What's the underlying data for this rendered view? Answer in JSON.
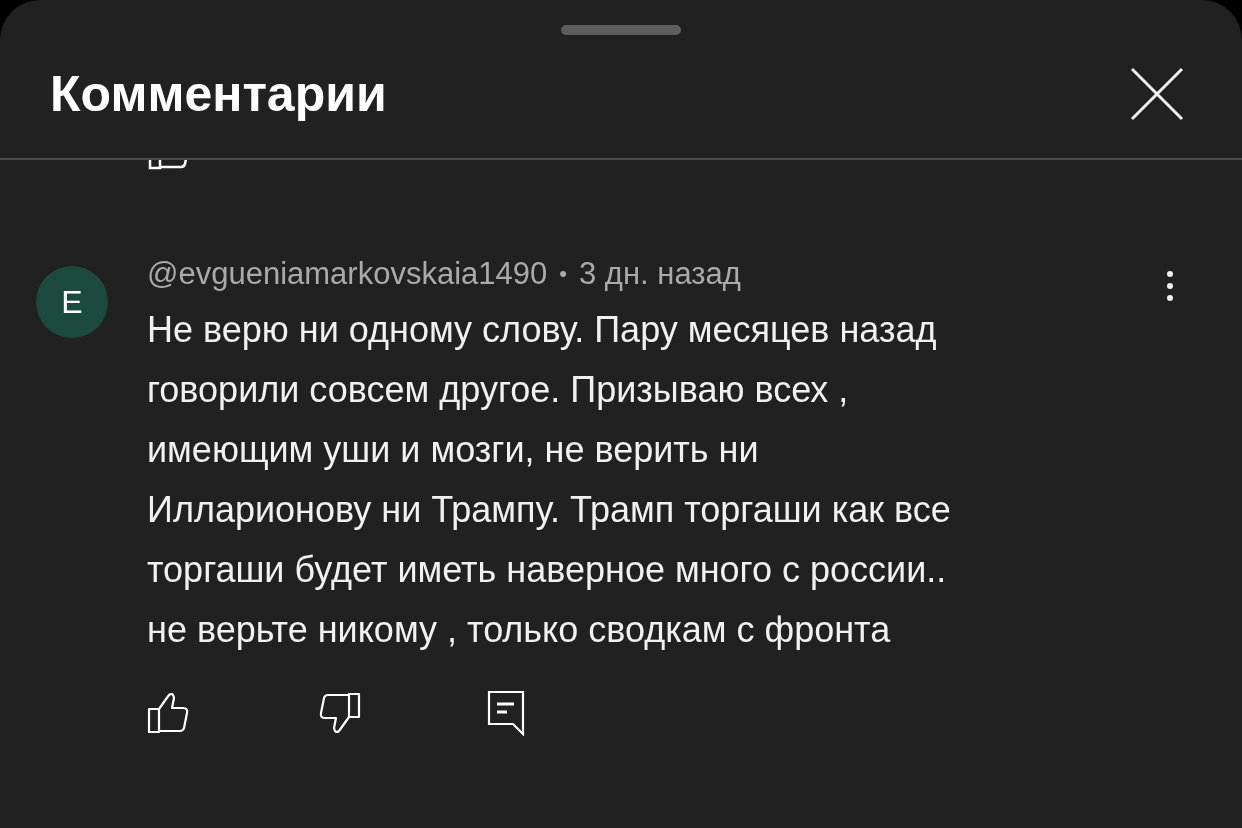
{
  "sheet": {
    "title": "Комментарии"
  },
  "comment": {
    "avatar_letter": "Е",
    "author": "@evgueniamarkovskaia1490",
    "separator": "•",
    "time": "3 дн. назад",
    "text": "Не верю ни одному слову. Пару месяцев назад\nговорили совсем другое. Призываю всех ,\nимеющим уши и мозги, не верить ни\nИлларионову ни Трампу. Трамп торгаши как все\nторгаши будет иметь наверное много с россии..\nне верьте никому , только сводкам с фронта"
  }
}
